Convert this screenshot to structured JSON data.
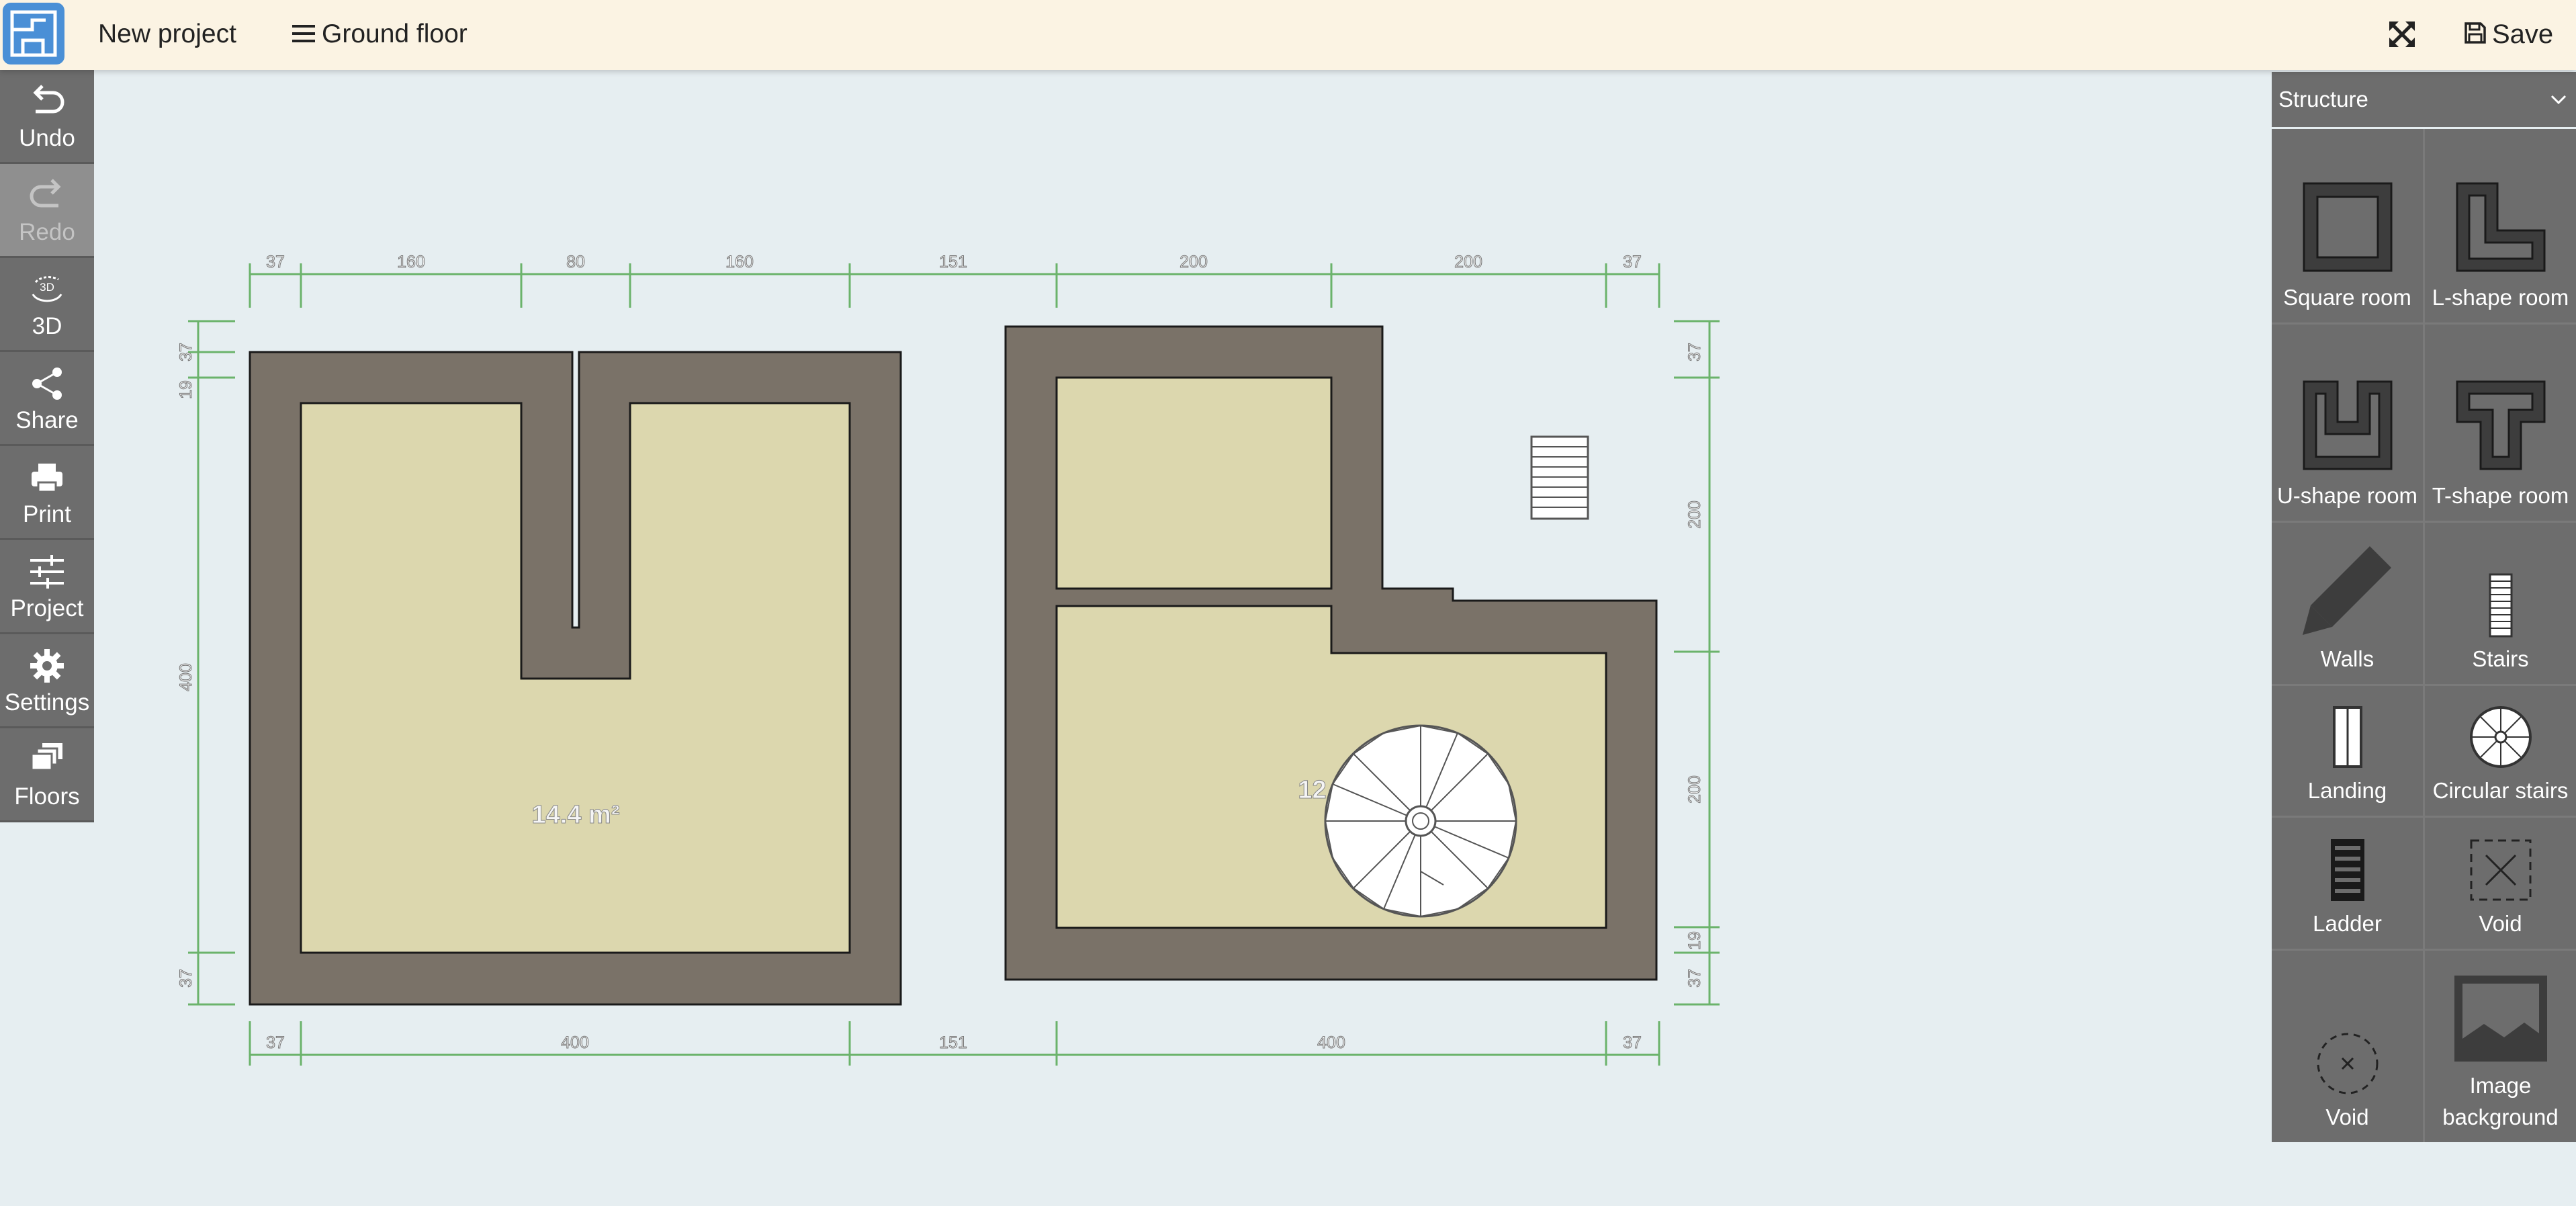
{
  "topbar": {
    "project_name": "New project",
    "floor_menu": "Ground floor",
    "save_label": "Save",
    "fullscreen_icon": "expand-icon",
    "logo_icon": "floorplan-logo-icon"
  },
  "left_toolbar": [
    {
      "label": "Undo",
      "icon": "undo-icon",
      "enabled": true
    },
    {
      "label": "Redo",
      "icon": "redo-icon",
      "enabled": false
    },
    {
      "label": "3D",
      "icon": "3d-rotate-icon",
      "enabled": true
    },
    {
      "label": "Share",
      "icon": "share-icon",
      "enabled": true
    },
    {
      "label": "Print",
      "icon": "print-icon",
      "enabled": true
    },
    {
      "label": "Project",
      "icon": "sliders-icon",
      "enabled": true
    },
    {
      "label": "Settings",
      "icon": "gear-icon",
      "enabled": true
    },
    {
      "label": "Floors",
      "icon": "layers-icon",
      "enabled": true
    }
  ],
  "right_panel": {
    "category": "Structure",
    "items": [
      {
        "label": "Square room",
        "icon": "square-room-icon"
      },
      {
        "label": "L-shape room",
        "icon": "l-shape-room-icon"
      },
      {
        "label": "U-shape room",
        "icon": "u-shape-room-icon"
      },
      {
        "label": "T-shape room",
        "icon": "t-shape-room-icon"
      },
      {
        "label": "Walls",
        "icon": "pencil-icon"
      },
      {
        "label": "Stairs",
        "icon": "stairs-icon"
      },
      {
        "label": "Landing",
        "icon": "landing-icon"
      },
      {
        "label": "Circular stairs",
        "icon": "circular-stairs-icon"
      },
      {
        "label": "Ladder",
        "icon": "ladder-icon"
      },
      {
        "label": "Void",
        "icon": "void-square-icon"
      },
      {
        "label": "Void",
        "icon": "void-circle-icon"
      },
      {
        "label": "Image background",
        "icon": "image-icon"
      }
    ]
  },
  "plan": {
    "room_left_area": "14.4 m²",
    "room_right_area": "12 m²",
    "dims_top": [
      "37",
      "160",
      "80",
      "160",
      "151",
      "200",
      "200",
      "37"
    ],
    "dims_bottom": [
      "37",
      "400",
      "151",
      "400",
      "37"
    ],
    "dims_left": [
      "37",
      "19",
      "400",
      "37"
    ],
    "dims_right": [
      "37",
      "200",
      "200",
      "19",
      "37"
    ]
  },
  "colors": {
    "topbar_bg": "#fbf3e3",
    "canvas_bg": "#e6eef1",
    "panel_bg": "#6d6d6d",
    "wall": "#7a7268",
    "floor": "#dcd7ae",
    "dimension": "#6bb36b"
  }
}
